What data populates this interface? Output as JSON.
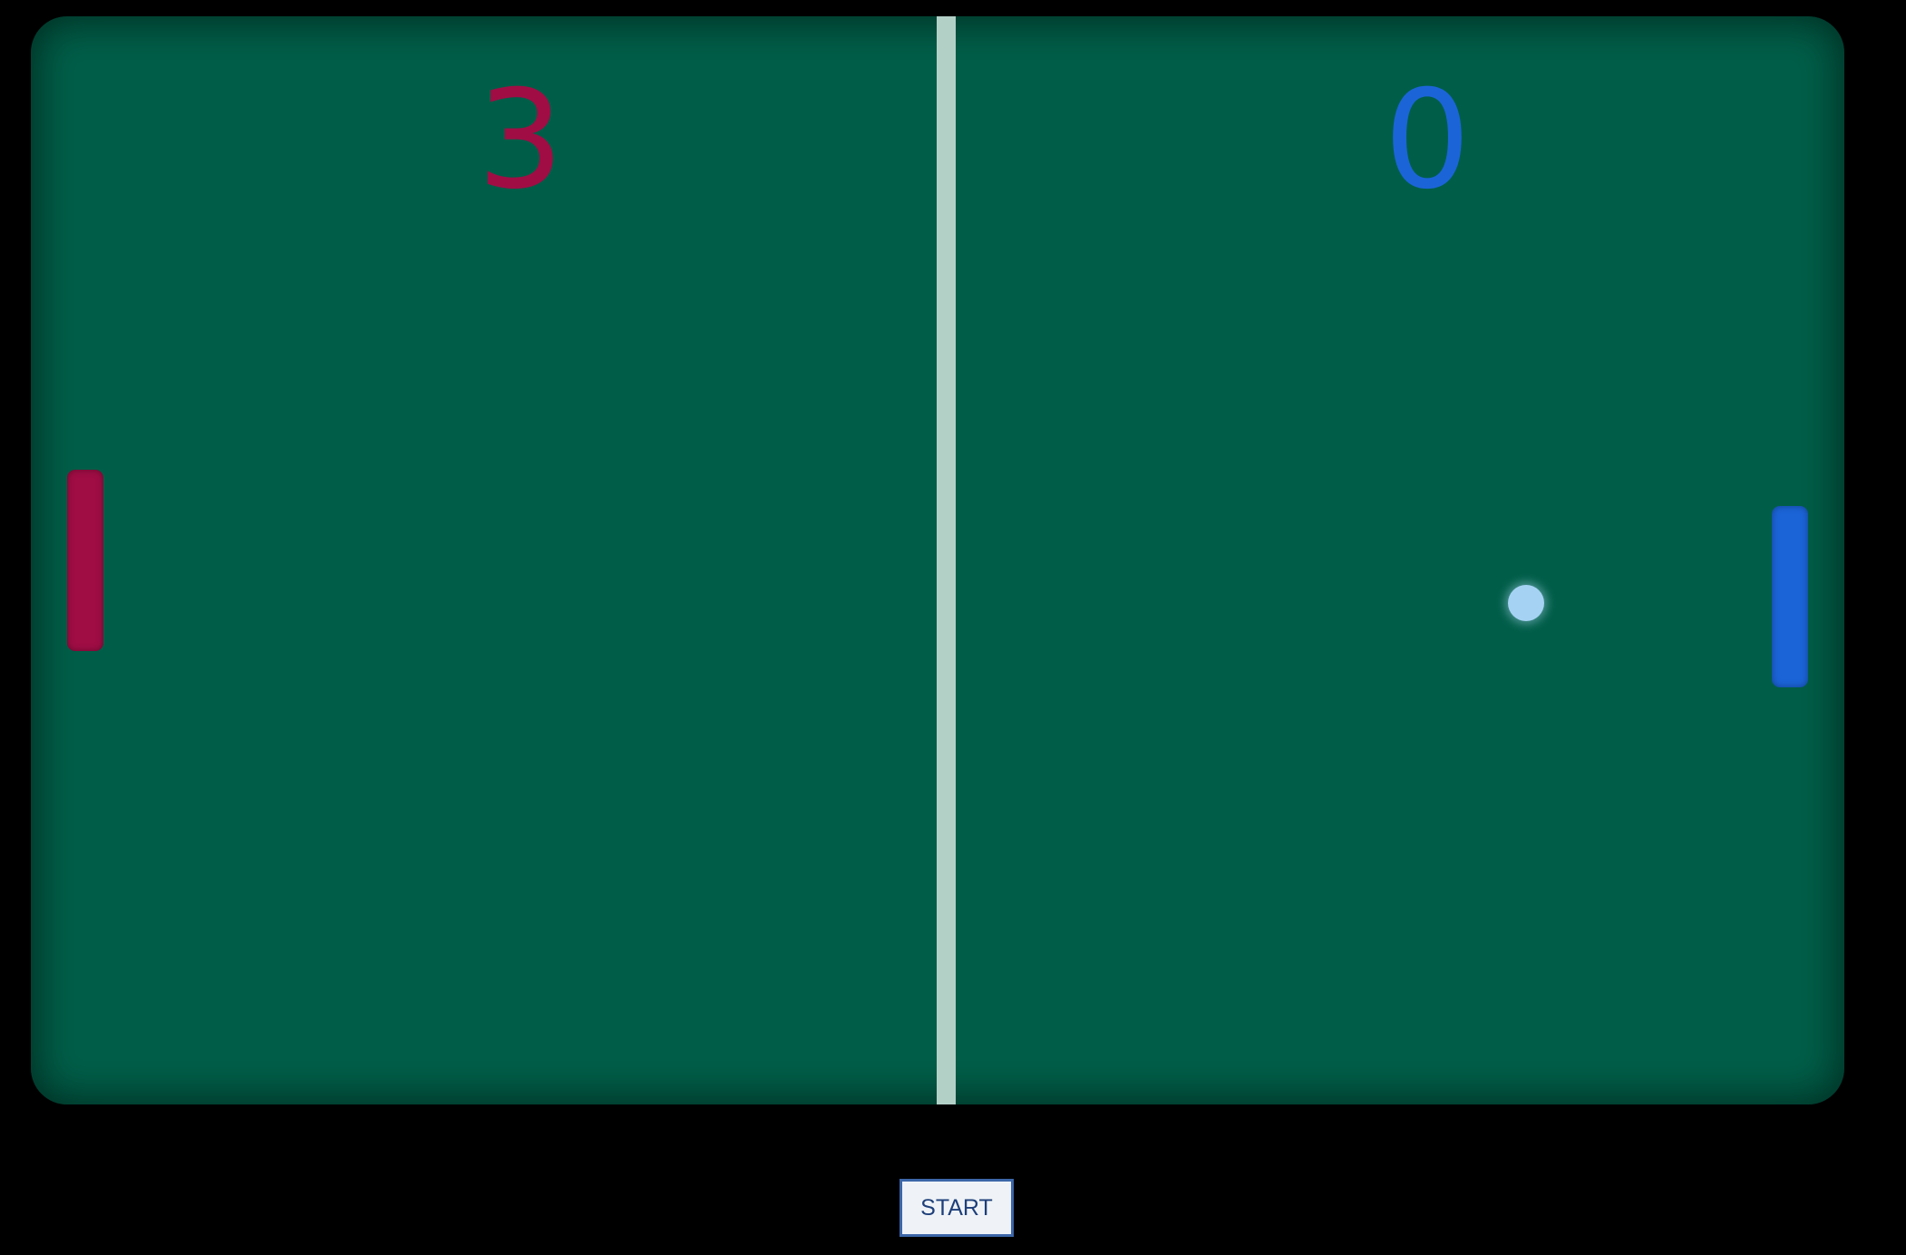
{
  "game": {
    "score_left": "3",
    "score_right": "0"
  },
  "controls": {
    "start_label": "START"
  },
  "colors": {
    "table": "#005e48",
    "net": "#b3d0c7",
    "left_player": "#a00d45",
    "right_player": "#1b64d8",
    "ball": "#a5d2f3",
    "background": "#000000"
  }
}
